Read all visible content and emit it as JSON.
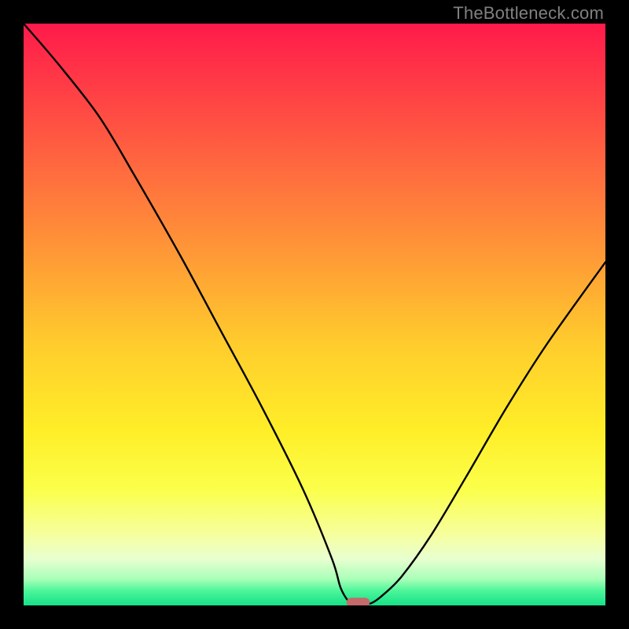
{
  "watermark": "TheBottleneck.com",
  "chart_data": {
    "type": "line",
    "title": "",
    "xlabel": "",
    "ylabel": "",
    "xlim": [
      0,
      100
    ],
    "ylim": [
      0,
      100
    ],
    "grid": false,
    "legend": false,
    "x": [
      0,
      6,
      13,
      19,
      27,
      34,
      41,
      48,
      53,
      54.5,
      56,
      57,
      58,
      60,
      62,
      65,
      70,
      76,
      83,
      90,
      100
    ],
    "values": [
      100,
      93,
      84,
      74,
      60,
      47,
      34,
      20,
      8,
      3,
      0.5,
      0,
      0,
      0.5,
      2,
      5,
      12,
      22,
      34,
      45,
      59
    ],
    "marker": {
      "x_range": [
        55.5,
        59.5
      ],
      "y": 0.5,
      "color": "#c46a6a"
    },
    "background_gradient": {
      "stops": [
        {
          "pos": 0.0,
          "color": "#ff1a4b"
        },
        {
          "pos": 0.1,
          "color": "#ff3a46"
        },
        {
          "pos": 0.25,
          "color": "#ff6a3f"
        },
        {
          "pos": 0.4,
          "color": "#ff9a36"
        },
        {
          "pos": 0.55,
          "color": "#ffcc2d"
        },
        {
          "pos": 0.7,
          "color": "#ffee28"
        },
        {
          "pos": 0.8,
          "color": "#fbff4a"
        },
        {
          "pos": 0.88,
          "color": "#f6ffa0"
        },
        {
          "pos": 0.92,
          "color": "#e8ffd0"
        },
        {
          "pos": 0.955,
          "color": "#a8ffb8"
        },
        {
          "pos": 0.975,
          "color": "#4cf59a"
        },
        {
          "pos": 1.0,
          "color": "#16e188"
        }
      ]
    }
  }
}
